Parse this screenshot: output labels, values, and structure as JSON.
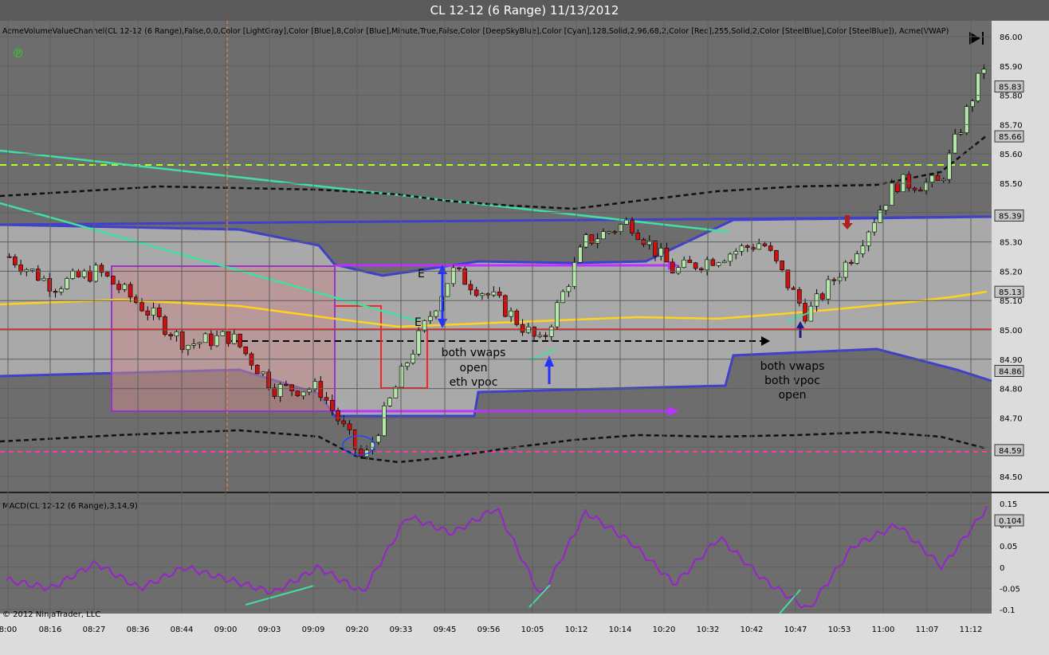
{
  "window": {
    "title": "CL 12-12 (6 Range)  11/13/2012"
  },
  "price_panel": {
    "indicator_label": "AcmeVolumeValueChannel(CL 12-12 (6 Range),False,0,0,Color [LightGray],Color [Blue],8,Color [Blue],Minute,True,False,Color [DeepSkyBlue],Color [Cyan],128,Solid,2,96,68,2,Color [Red],255,Solid,2,Color [SteelBlue],Color [SteelBlue]), Acme(VWAP)",
    "logo_glyph": "℗",
    "price_axis": [
      "86.00",
      "85.90",
      "85.80",
      "85.70",
      "85.60",
      "85.50",
      "85.40",
      "85.30",
      "85.20",
      "85.10",
      "85.00",
      "84.90",
      "84.80",
      "84.70",
      "84.60",
      "84.50"
    ],
    "price_tags": [
      {
        "label": "85.83",
        "color": "#c8c8c8"
      },
      {
        "label": "85.66",
        "color": "#c8c8c8"
      },
      {
        "label": "85.39",
        "color": "#c8c8c8"
      },
      {
        "label": "85.13",
        "color": "#c8c8c8"
      },
      {
        "label": "84.86",
        "color": "#c8c8c8"
      },
      {
        "label": "84.59",
        "color": "#c8c8c8"
      }
    ],
    "annotations": [
      {
        "text": "E"
      },
      {
        "text": "E"
      },
      {
        "text": "both vwaps"
      },
      {
        "text": "open"
      },
      {
        "text": "eth vpoc"
      },
      {
        "text": "both vwaps"
      },
      {
        "text": "both vpoc"
      },
      {
        "text": "open"
      }
    ]
  },
  "macd_panel": {
    "label": "MACD(CL 12-12 (6 Range),3,14,9)",
    "axis": [
      "0.15",
      "0.1",
      "0.05",
      "0",
      "-0.05",
      "-0.1"
    ],
    "value_tag": "0.104",
    "copyright": "© 2012 NinjaTrader, LLC"
  },
  "time_axis": [
    "8:00",
    "08:16",
    "08:27",
    "08:36",
    "08:44",
    "09:00",
    "09:03",
    "09:09",
    "09:20",
    "09:33",
    "09:45",
    "09:56",
    "10:05",
    "10:12",
    "10:14",
    "10:20",
    "10:32",
    "10:42",
    "10:47",
    "10:53",
    "11:00",
    "11:07",
    "11:12"
  ],
  "colors": {
    "up": "#b4e8a8",
    "down": "#cc1010",
    "macd": "#9922cc",
    "vwap": "#ffd21f",
    "channel": "#4040c8",
    "trend": "#40e0a0",
    "box": "#9933cc"
  },
  "chart_data": [
    {
      "type": "line",
      "title": "CL 12-12 (6 Range)  11/13/2012",
      "ylim": [
        84.45,
        86.02
      ],
      "x": [
        "8:00",
        "08:16",
        "08:27",
        "08:36",
        "08:44",
        "09:00",
        "09:03",
        "09:09",
        "09:20",
        "09:33",
        "09:45",
        "09:56",
        "10:05",
        "10:12",
        "10:14",
        "10:20",
        "10:32",
        "10:42",
        "10:47",
        "10:53",
        "11:00",
        "11:07",
        "11:12"
      ],
      "series": [
        {
          "values": [
            85.25,
            85.15,
            85.2,
            85.08,
            84.95,
            84.98,
            84.8,
            84.8,
            84.55,
            84.9,
            85.2,
            85.1,
            84.95,
            85.3,
            85.37,
            85.2,
            85.25,
            85.3,
            85.05,
            85.25,
            85.5,
            85.5,
            85.9
          ]
        }
      ]
    },
    {
      "type": "line",
      "title": "MACD(CL 12-12 (6 Range),3,14,9)",
      "ylim": [
        -0.11,
        0.16
      ],
      "x": [
        "8:00",
        "08:16",
        "08:27",
        "08:36",
        "08:44",
        "09:00",
        "09:03",
        "09:09",
        "09:20",
        "09:33",
        "09:45",
        "09:56",
        "10:05",
        "10:12",
        "10:14",
        "10:20",
        "10:32",
        "10:42",
        "10:47",
        "10:53",
        "11:00",
        "11:07",
        "11:12"
      ],
      "series": [
        {
          "values": [
            -0.03,
            -0.05,
            0.01,
            -0.05,
            0.0,
            -0.03,
            -0.06,
            0.0,
            -0.06,
            0.12,
            0.08,
            0.14,
            -0.07,
            0.13,
            0.06,
            -0.04,
            0.07,
            -0.03,
            -0.1,
            0.05,
            0.1,
            0.0,
            0.14
          ]
        }
      ]
    }
  ]
}
